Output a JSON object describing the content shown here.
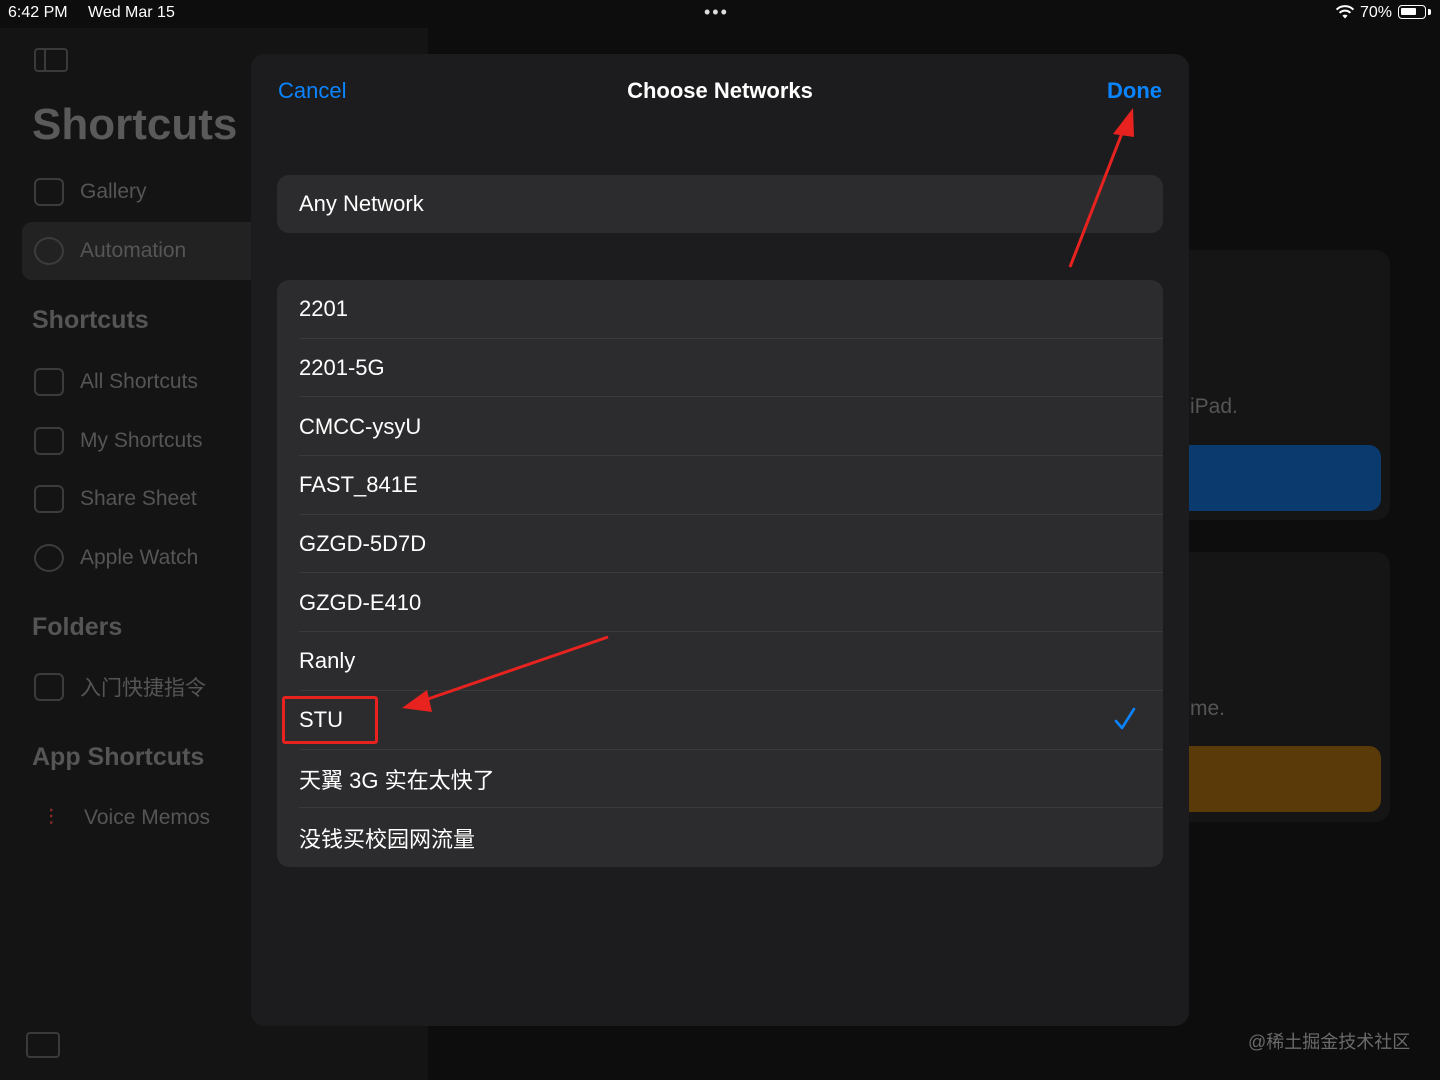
{
  "status_bar": {
    "time": "6:42 PM",
    "date": "Wed Mar 15",
    "dots": "•••",
    "battery_text": "70%",
    "battery_level": 0.7
  },
  "sidebar": {
    "title": "Shortcuts",
    "top_items": [
      {
        "label": "Gallery",
        "icon": "gallery-icon"
      },
      {
        "label": "Automation",
        "icon": "clock-icon",
        "active": true
      }
    ],
    "shortcuts_header": "Shortcuts",
    "shortcuts_items": [
      {
        "label": "All Shortcuts",
        "icon": "grid-icon"
      },
      {
        "label": "My Shortcuts",
        "icon": "person-icon"
      },
      {
        "label": "Share Sheet",
        "icon": "share-icon"
      },
      {
        "label": "Apple Watch",
        "icon": "watch-icon"
      }
    ],
    "folders_header": "Folders",
    "folders_items": [
      {
        "label": "入门快捷指令",
        "icon": "folder-icon"
      }
    ],
    "app_shortcuts_header": "App Shortcuts",
    "app_items": [
      {
        "label": "Voice Memos",
        "icon": "waveform-icon"
      }
    ]
  },
  "background": {
    "text1": "iPad.",
    "text2": "me."
  },
  "modal": {
    "cancel_label": "Cancel",
    "title": "Choose Networks",
    "done_label": "Done",
    "any_network_label": "Any Network",
    "networks": [
      {
        "name": "2201",
        "selected": false
      },
      {
        "name": "2201-5G",
        "selected": false
      },
      {
        "name": "CMCC-ysyU",
        "selected": false
      },
      {
        "name": "FAST_841E",
        "selected": false
      },
      {
        "name": "GZGD-5D7D",
        "selected": false
      },
      {
        "name": "GZGD-E410",
        "selected": false
      },
      {
        "name": "Ranly",
        "selected": false
      },
      {
        "name": "STU",
        "selected": true
      },
      {
        "name": "天翼 3G 实在太快了",
        "selected": false
      },
      {
        "name": "没钱买校园网流量",
        "selected": false
      }
    ]
  },
  "colors": {
    "accent": "#0a84ff",
    "annotation": "#e8231f"
  },
  "watermark": "@稀土掘金技术社区"
}
